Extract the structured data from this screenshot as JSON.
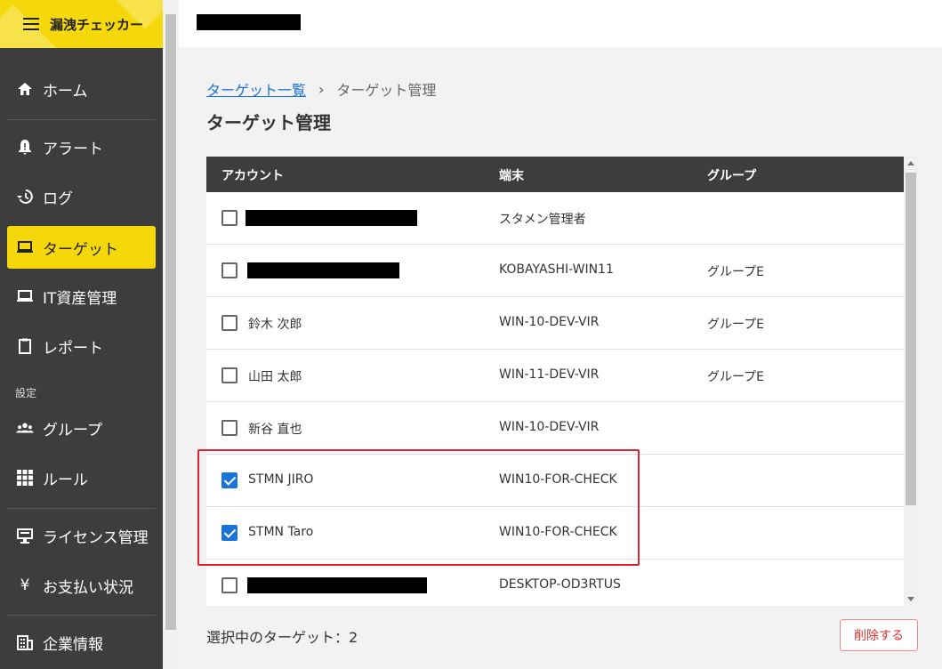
{
  "app": {
    "title": "漏洩チェッカー"
  },
  "sidebar": {
    "items": [
      {
        "label": "ホーム",
        "icon": "home-icon"
      },
      {
        "label": "アラート",
        "icon": "alert-bell-icon"
      },
      {
        "label": "ログ",
        "icon": "history-icon"
      },
      {
        "label": "ターゲット",
        "icon": "laptop-user-icon",
        "active": true
      },
      {
        "label": "IT資産管理",
        "icon": "laptop-icon"
      },
      {
        "label": "レポート",
        "icon": "clipboard-icon"
      },
      {
        "label": "グループ",
        "icon": "people-icon"
      },
      {
        "label": "ルール",
        "icon": "grid-icon"
      },
      {
        "label": "ライセンス管理",
        "icon": "license-icon"
      },
      {
        "label": "お支払い状況",
        "icon": "yen-icon"
      },
      {
        "label": "企業情報",
        "icon": "building-icon"
      }
    ],
    "section_settings": "設定"
  },
  "breadcrumb": {
    "parent": "ターゲット一覧",
    "current": "ターゲット管理"
  },
  "page": {
    "title": "ターゲット管理"
  },
  "table": {
    "headers": {
      "account": "アカウント",
      "terminal": "端末",
      "group": "グループ"
    },
    "rows": [
      {
        "account": "",
        "terminal": "スタメン管理者",
        "group": "",
        "checked": false,
        "redacted": true
      },
      {
        "account": "",
        "terminal": "KOBAYASHI-WIN11",
        "group": "グループE",
        "checked": false,
        "redacted": true
      },
      {
        "account": "鈴木 次郎",
        "terminal": "WIN-10-DEV-VIR",
        "group": "グループE",
        "checked": false
      },
      {
        "account": "山田 太郎",
        "terminal": "WIN-11-DEV-VIR",
        "group": "グループE",
        "checked": false
      },
      {
        "account": "新谷 直也",
        "terminal": "WIN-10-DEV-VIR",
        "group": "",
        "checked": false
      },
      {
        "account": "STMN JIRO",
        "terminal": "WIN10-FOR-CHECK",
        "group": "",
        "checked": true
      },
      {
        "account": "STMN Taro",
        "terminal": "WIN10-FOR-CHECK",
        "group": "",
        "checked": true
      },
      {
        "account": "",
        "terminal": "DESKTOP-OD3RTUS",
        "group": "",
        "checked": false,
        "redacted": true
      }
    ]
  },
  "footer": {
    "selected_text": "選択中のターゲット：2",
    "delete_label": "削除する"
  },
  "colors": {
    "accent": "#f5d80c",
    "sidebar_bg": "#3d3d3d",
    "link": "#1a73d9",
    "danger": "#e0252e"
  }
}
